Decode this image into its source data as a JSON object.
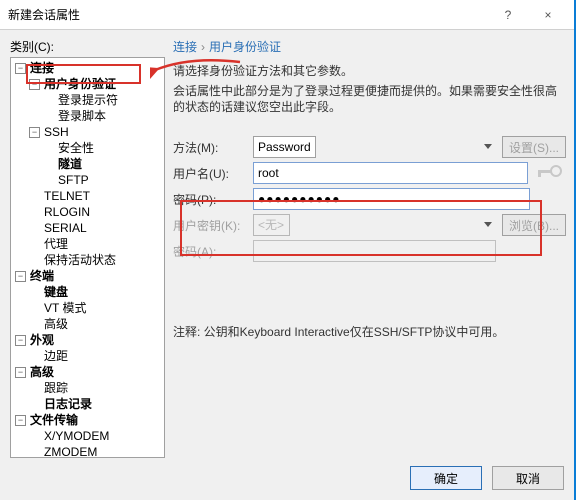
{
  "window": {
    "title": "新建会话属性",
    "help_icon": "?",
    "close_icon": "×"
  },
  "left": {
    "category_label": "类别(C):"
  },
  "tree": {
    "connect": "连接",
    "auth": "用户身份验证",
    "login_prompt": "登录提示符",
    "login_script": "登录脚本",
    "ssh": "SSH",
    "security": "安全性",
    "tunnel": "隧道",
    "sftp": "SFTP",
    "telnet": "TELNET",
    "rlogin": "RLOGIN",
    "serial": "SERIAL",
    "proxy": "代理",
    "keepalive": "保持活动状态",
    "terminal": "终端",
    "keyboard": "键盘",
    "vt": "VT 模式",
    "advanced": "高级",
    "appearance": "外观",
    "margin": "边距",
    "adv2": "高级",
    "trace": "跟踪",
    "log": "日志记录",
    "ft": "文件传输",
    "xymodem": "X/YMODEM",
    "zmodem": "ZMODEM"
  },
  "right": {
    "crumb1": "连接",
    "crumb2": "用户身份验证",
    "desc1": "请选择身份验证方法和其它参数。",
    "desc2": "会话属性中此部分是为了登录过程更便捷而提供的。如果需要安全性很高的状态的话建议您空出此字段。"
  },
  "form": {
    "method_label": "方法(M):",
    "method_value": "Password",
    "setup_btn": "设置(S)...",
    "user_label": "用户名(U):",
    "user_value": "root",
    "pass_label": "密码(P):",
    "pass_value": "●●●●●●●●●●",
    "userkey_label": "用户密钥(K):",
    "userkey_value": "<无>",
    "browse_btn": "浏览(B)...",
    "pass2_label": "密码(A):"
  },
  "note": "注释: 公钥和Keyboard Interactive仅在SSH/SFTP协议中可用。",
  "footer": {
    "ok": "确定",
    "cancel": "取消"
  }
}
